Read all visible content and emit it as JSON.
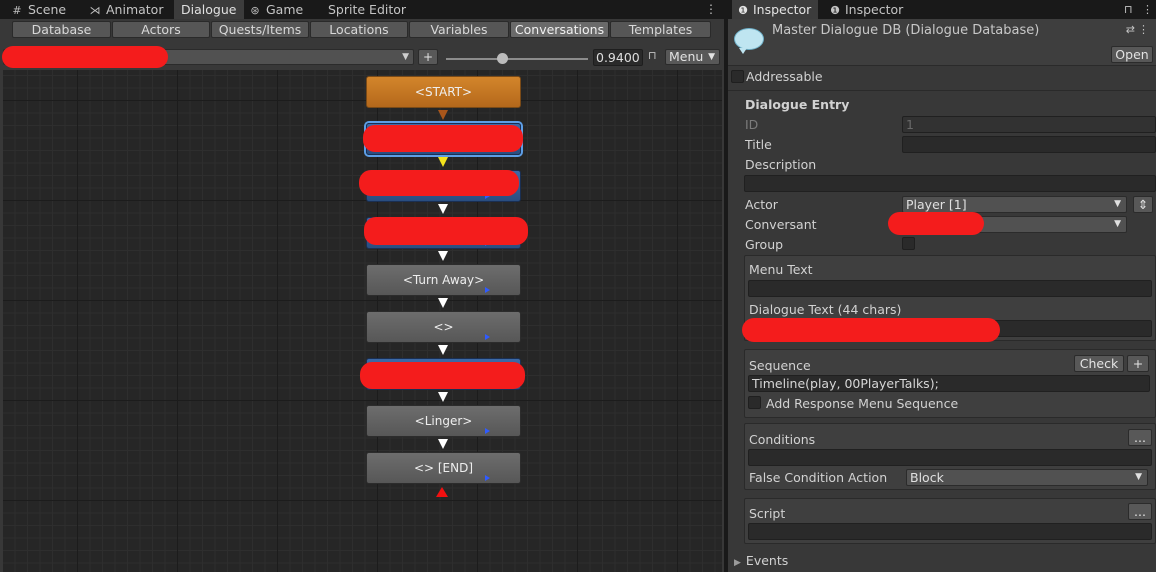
{
  "editor_tabs": [
    {
      "label": "Scene",
      "icon": "grid-icon"
    },
    {
      "label": "Animator",
      "icon": "animator-icon"
    },
    {
      "label": "Dialogue",
      "icon": ""
    },
    {
      "label": "Game",
      "icon": "gamepad-icon"
    },
    {
      "label": "Sprite Editor",
      "icon": ""
    }
  ],
  "db_tabs": [
    "Database",
    "Actors",
    "Quests/Items",
    "Locations",
    "Variables",
    "Conversations",
    "Templates"
  ],
  "conversation_toolbar": {
    "add_label": "+",
    "zoom_value": "0.9400",
    "zoom_fraction": 0.4,
    "menu_label": "Menu"
  },
  "nodes": [
    {
      "label": "<START>",
      "style": "start"
    },
    {
      "label": "",
      "style": "blue",
      "selected": true
    },
    {
      "label": "",
      "style": "blue"
    },
    {
      "label": "",
      "style": "blue"
    },
    {
      "label": "<Turn Away>",
      "style": "gray"
    },
    {
      "label": "<>",
      "style": "gray"
    },
    {
      "label": "",
      "style": "blue"
    },
    {
      "label": "<Linger>",
      "style": "gray"
    },
    {
      "label": "<> [END]",
      "style": "gray"
    }
  ],
  "inspector": {
    "tabs": [
      "Inspector",
      "Inspector"
    ],
    "db_title": "Master Dialogue DB (Dialogue Database)",
    "open_label": "Open",
    "addressable_label": "Addressable",
    "section_title": "Dialogue Entry",
    "id_label": "ID",
    "id_value": "1",
    "title_label": "Title",
    "title_value": "",
    "description_label": "Description",
    "description_value": "",
    "actor_label": "Actor",
    "actor_value": "Player [1]",
    "conversant_label": "Conversant",
    "conversant_value": "",
    "group_label": "Group",
    "menu_text_label": "Menu Text",
    "menu_text_value": "",
    "dialogue_text_label": "Dialogue Text (44 chars)",
    "sequence_label": "Sequence",
    "check_label": "Check",
    "plus_label": "+",
    "sequence_value": "Timeline(play, 00PlayerTalks);",
    "add_response_label": "Add Response Menu Sequence",
    "conditions_label": "Conditions",
    "ellipsis_label": "...",
    "false_condition_label": "False Condition Action",
    "false_condition_value": "Block",
    "script_label": "Script",
    "events_label": "Events"
  },
  "colors": {
    "start_node": "#c77722",
    "blue_node": "#345d96",
    "gray_node": "#626262",
    "selection": "#5d9ee6",
    "end_marker": "#f21010",
    "link_yellow": "#f4e31c",
    "redaction": "#f41c1c"
  }
}
